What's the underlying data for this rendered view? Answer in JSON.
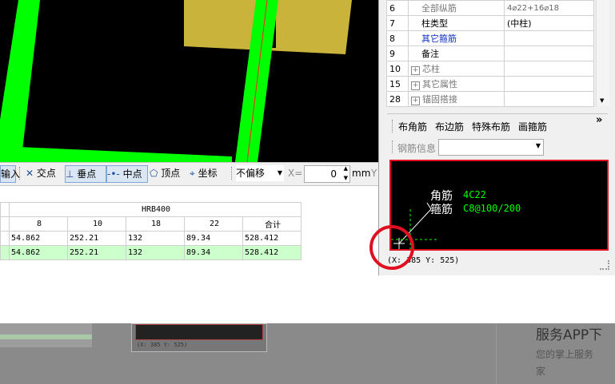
{
  "toolbar": {
    "input_label": "输入",
    "intersection_label": "交点",
    "perpendicular_label": "垂点",
    "midpoint_label": "中点",
    "vertex_label": "顶点",
    "coordinate_label": "坐标",
    "offset_select": "不偏移",
    "x_label": "X=",
    "x_value": "0",
    "unit": "mm",
    "y_label": "Y"
  },
  "table": {
    "grade": "HRB400",
    "columns": [
      "8",
      "10",
      "18",
      "22",
      "合计"
    ],
    "rows": [
      [
        "54.862",
        "252.21",
        "132",
        "89.34",
        "528.412"
      ],
      [
        "54.862",
        "252.21",
        "132",
        "89.34",
        "528.412"
      ]
    ]
  },
  "properties": [
    {
      "no": "6",
      "name": "全部纵筋",
      "value": "4⌀22+16⌀18",
      "expand": false,
      "style": "grey"
    },
    {
      "no": "7",
      "name": "柱类型",
      "value": "(中柱)",
      "expand": false,
      "style": "normal"
    },
    {
      "no": "8",
      "name": "其它箍筋",
      "value": "",
      "expand": false,
      "style": "blue"
    },
    {
      "no": "9",
      "name": "备注",
      "value": "",
      "expand": false,
      "style": "normal"
    },
    {
      "no": "10",
      "name": "芯柱",
      "value": "",
      "expand": true,
      "style": "grey"
    },
    {
      "no": "15",
      "name": "其它属性",
      "value": "",
      "expand": true,
      "style": "grey"
    },
    {
      "no": "28",
      "name": "锚固搭接",
      "value": "",
      "expand": true,
      "style": "grey"
    }
  ],
  "panel_tabs": {
    "corner": "布角筋",
    "edge": "布边筋",
    "special": "特殊布筋",
    "stirrup": "画箍筋",
    "more": "»"
  },
  "rebar_info_label": "钢筋信息",
  "rebar_info_value": "",
  "preview": {
    "corner_label": "角筋",
    "corner_value": "4C22",
    "stirrup_label": "箍筋",
    "stirrup_value": "C8@100/200"
  },
  "status_text": "(X: 385 Y: 525)",
  "bg_page": {
    "title": "服务APP下",
    "subtitle": "您的掌上服务",
    "subtitle2": "家",
    "mini_status": "(X: 385 Y: 525)"
  },
  "colors": {
    "canvas": "#000000",
    "wall": "#00ff00",
    "slab": "#c9b33a",
    "preview_text": "#00ff00",
    "highlight": "#e01020"
  }
}
